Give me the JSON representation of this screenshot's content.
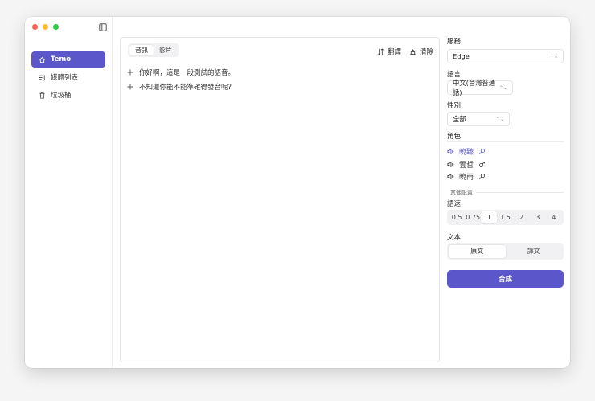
{
  "sidebar": {
    "items": [
      {
        "label": "Temo",
        "icon": "home-icon",
        "active": true
      },
      {
        "label": "媒體列表",
        "icon": "media-list-icon",
        "active": false
      },
      {
        "label": "垃圾桶",
        "icon": "trash-icon",
        "active": false
      }
    ]
  },
  "main": {
    "tabs": [
      {
        "label": "音訊",
        "active": true
      },
      {
        "label": "影片",
        "active": false
      }
    ],
    "actions": {
      "translate": "翻譯",
      "clear": "清除"
    },
    "lines": [
      "你好啊，這是一段測試的語音。",
      "不知道你能不能準確得發音呢？"
    ]
  },
  "settings": {
    "service_label": "服務",
    "service_value": "Edge",
    "language_label": "語言",
    "language_value": "中文(台灣普通話)",
    "gender_label": "性別",
    "gender_value": "全部",
    "role_label": "角色",
    "roles": [
      {
        "name": "曉臻",
        "symbol": "♀",
        "active": true
      },
      {
        "name": "雲哲",
        "symbol": "♂",
        "active": false
      },
      {
        "name": "曉雨",
        "symbol": "♀",
        "active": false
      }
    ],
    "other_label": "其他設置",
    "speed_label": "語速",
    "speeds": [
      "0.5",
      "0.75",
      "1",
      "1.5",
      "2",
      "3",
      "4"
    ],
    "speed_selected": "1",
    "text_label": "文本",
    "text_tabs": [
      {
        "label": "原文",
        "active": true
      },
      {
        "label": "譯文",
        "active": false
      }
    ],
    "synth_label": "合成"
  },
  "colors": {
    "accent": "#5b56c9"
  }
}
